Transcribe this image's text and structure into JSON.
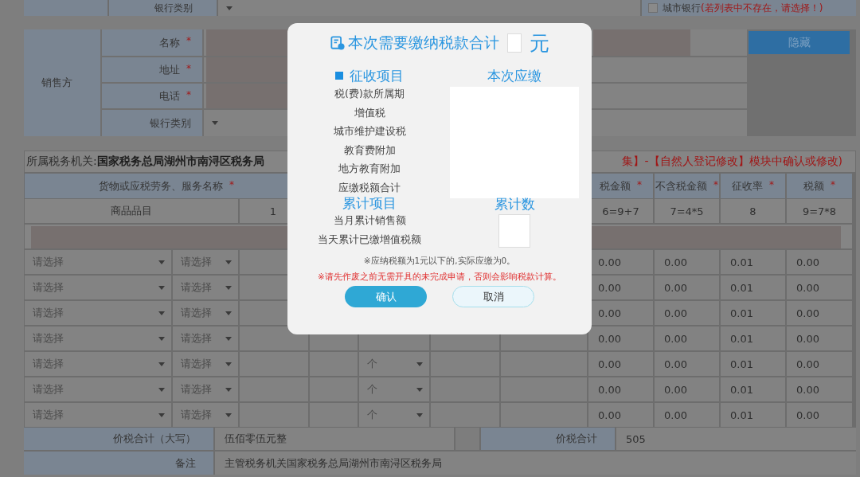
{
  "bank_row": {
    "label": "银行类别",
    "checkbox": {
      "checked": false
    },
    "checkbox_label": "城市银行",
    "hint": "(若列表中不存在，请选择！)"
  },
  "seller": {
    "title": "销售方",
    "hide_button": "隐藏",
    "fields": [
      {
        "label": "名称",
        "mark": "*",
        "kind": "text"
      },
      {
        "label": "地址",
        "mark": "*",
        "kind": "text"
      },
      {
        "label": "电话",
        "mark": "*",
        "kind": "text"
      },
      {
        "label": "银行类别",
        "kind": "select"
      }
    ]
  },
  "tax_office": {
    "text": "所属税务机关:**国家税务总局湖州市南浔区税务局**",
    "notice": "集】-【自然人登记修改】模块中确认或修改)"
  },
  "items_table": {
    "name_column": {
      "label": "货物或应税劳务、服务名称",
      "mark": "*"
    },
    "columns": [
      {
        "label": "税金额",
        "mark": "*"
      },
      {
        "label": "不含税金额",
        "mark": "*"
      },
      {
        "label": "征收率",
        "mark": "*"
      },
      {
        "label": "税额",
        "mark": "*"
      }
    ],
    "index_row": {
      "name": "商品品目",
      "number": "1",
      "values": [
        "6=9+7",
        "7=4*5",
        "8",
        "9=7*8"
      ]
    },
    "rows": [
      {
        "name": "请选择",
        "type": "请选择",
        "values": [
          "0.00",
          "0.00",
          "0.01",
          "0.00"
        ]
      },
      {
        "name": "请选择",
        "type": "请选择",
        "values": [
          "0.00",
          "0.00",
          "0.01",
          "0.00"
        ]
      },
      {
        "name": "请选择",
        "type": "请选择",
        "values": [
          "0.00",
          "0.00",
          "0.01",
          "0.00"
        ]
      },
      {
        "name": "请选择",
        "type": "请选择",
        "values": [
          "0.00",
          "0.00",
          "0.01",
          "0.00"
        ]
      },
      {
        "name": "请选择",
        "type": "请选择",
        "unit": "个",
        "values": [
          "0.00",
          "0.00",
          "0.01",
          "0.00"
        ]
      },
      {
        "name": "请选择",
        "type": "请选择",
        "unit": "个",
        "values": [
          "0.00",
          "0.00",
          "0.01",
          "0.00"
        ]
      },
      {
        "name": "请选择",
        "type": "请选择",
        "unit": "个",
        "values": [
          "0.00",
          "0.00",
          "0.01",
          "0.00"
        ]
      }
    ]
  },
  "totals": {
    "words_label": "价税合计（大写）",
    "words": "伍佰零伍元整",
    "total_label": "价税合计",
    "total": "505",
    "remark_label": "备注",
    "remark": "主管税务机关国家税务总局湖州市南浔区税务局"
  },
  "dialog": {
    "title": "本次需要缴纳税款合计",
    "unit": "元",
    "left_heading": "征收项目",
    "right_heading": "本次应缴",
    "items": [
      "税(费)款所属期",
      "增值税",
      "城市维护建设税",
      "教育费附加",
      "地方教育附加",
      "应缴税额合计"
    ],
    "cum_heading": "累计项目",
    "cum_right_heading": "累计数",
    "cum_items": [
      "当月累计销售额",
      "当天累计已缴增值税额"
    ],
    "note": "※应纳税额为1元以下的,实际应缴为0。",
    "warning": "※请先作废之前无需开具的未完成申请，否则会影响税款计算。",
    "buttons": [
      {
        "label": "确认",
        "kind": "primary"
      },
      {
        "label": "取消",
        "kind": "secondary"
      }
    ]
  }
}
